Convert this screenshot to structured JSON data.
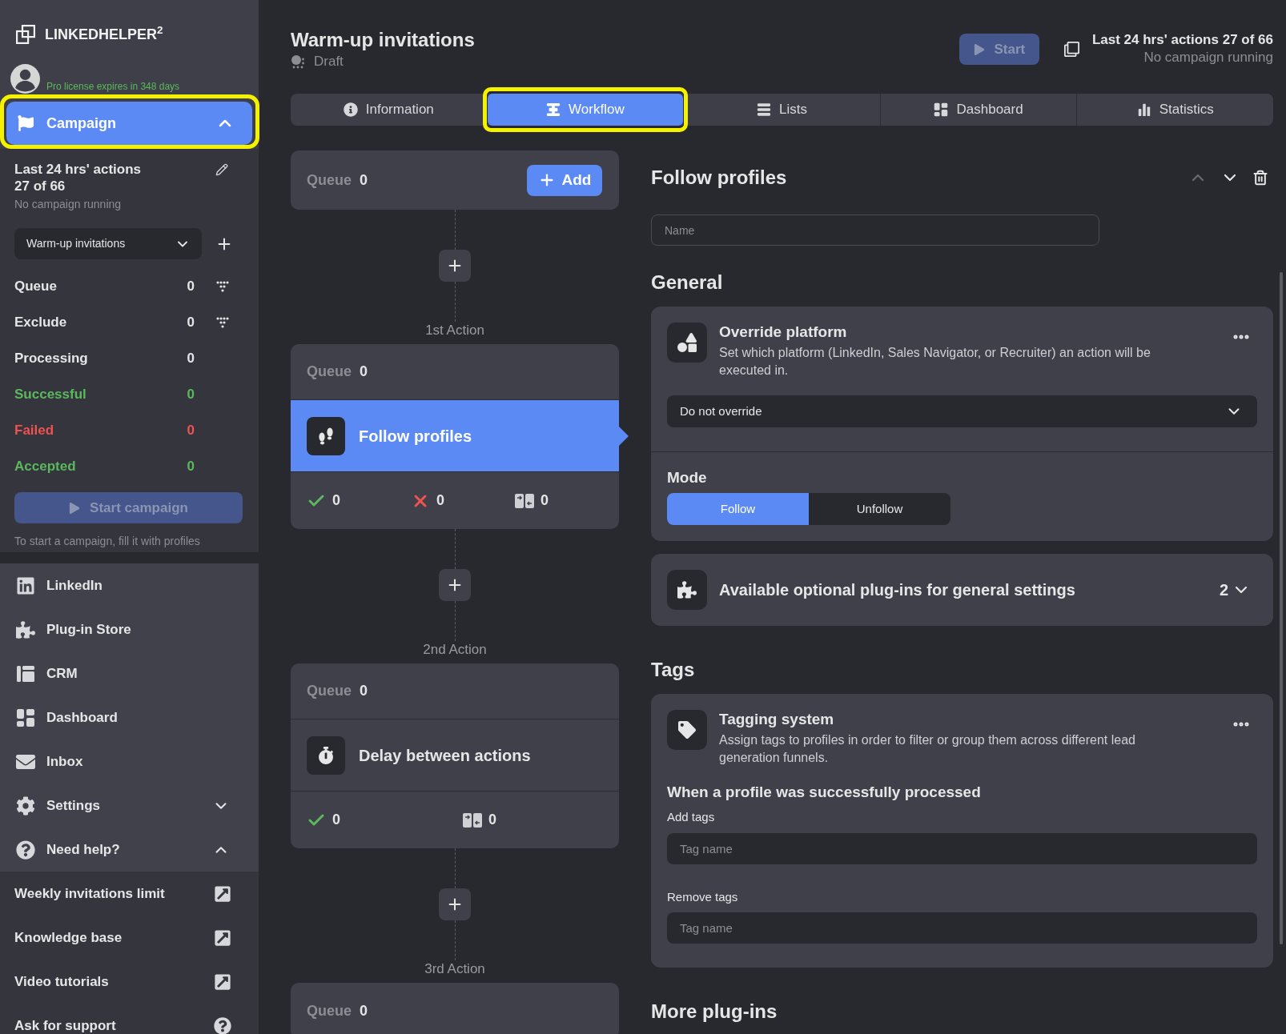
{
  "sidebar": {
    "logo": "LINKEDHELPER$^{2}$",
    "license": "Pro license expires in 348 days",
    "campaign_nav": {
      "label": "Campaign",
      "expanded": true,
      "highlighted": true
    },
    "actions_summary": {
      "title": "Last 24 hrs' actions",
      "count": "27 of 66",
      "status": "No campaign running"
    },
    "campaign_select": {
      "value": "Warm-up invitations"
    },
    "stats": [
      {
        "label": "Queue",
        "value": "0",
        "kind": "filter",
        "color": "#e6e6e6"
      },
      {
        "label": "Exclude",
        "value": "0",
        "kind": "filter",
        "color": "#e6e6e6"
      },
      {
        "label": "Processing",
        "value": "0",
        "kind": "plain",
        "color": "#e6e6e6"
      },
      {
        "label": "Successful",
        "value": "0",
        "kind": "plain",
        "color": "#5cb85c"
      },
      {
        "label": "Failed",
        "value": "0",
        "kind": "plain",
        "color": "#ee5350"
      },
      {
        "label": "Accepted",
        "value": "0",
        "kind": "plain",
        "color": "#5cb85c"
      }
    ],
    "start_button": {
      "label": "Start campaign",
      "disabled": true
    },
    "hint": "To start a campaign, fill it with profiles",
    "nav": [
      {
        "label": "LinkedIn"
      },
      {
        "label": "Plug-in Store"
      },
      {
        "label": "CRM"
      },
      {
        "label": "Dashboard"
      },
      {
        "label": "Inbox"
      },
      {
        "label": "Settings",
        "expanded": false
      },
      {
        "label": "Need help?",
        "expanded": true
      }
    ],
    "help_links": [
      {
        "label": "Weekly invitations limit",
        "kind": "external"
      },
      {
        "label": "Knowledge base",
        "kind": "external"
      },
      {
        "label": "Video tutorials",
        "kind": "external"
      },
      {
        "label": "Ask for support",
        "kind": "support"
      }
    ]
  },
  "header": {
    "title": "Warm-up invitations",
    "status": "Draft",
    "start_button": {
      "label": "Start",
      "disabled": true
    },
    "actions_summary": "Last 24 hrs' actions 27 of 66",
    "campaign_status": "No campaign running"
  },
  "tabs": [
    {
      "label": "Information",
      "selected": false,
      "highlighted": false
    },
    {
      "label": "Workflow",
      "selected": true,
      "highlighted": true
    },
    {
      "label": "Lists",
      "selected": false,
      "highlighted": false
    },
    {
      "label": "Dashboard",
      "selected": false,
      "highlighted": false
    },
    {
      "label": "Statistics",
      "selected": false,
      "highlighted": false
    }
  ],
  "workflow": {
    "source": {
      "queue_label": "Queue",
      "queue_count": "0",
      "add_button": "Add"
    },
    "steps": [
      {
        "step_label": "1st Action",
        "queue_label": "Queue",
        "queue_count": "0",
        "kind": "follow",
        "title": "Follow profiles",
        "selected": true,
        "results": [
          {
            "kind": "success",
            "count": "0"
          },
          {
            "kind": "failure",
            "count": "0"
          },
          {
            "kind": "skipped",
            "count": "0"
          }
        ]
      },
      {
        "step_label": "2nd Action",
        "queue_label": "Queue",
        "queue_count": "0",
        "kind": "delay",
        "title": "Delay between actions",
        "selected": false,
        "results": [
          {
            "kind": "success",
            "count": "0"
          },
          {
            "kind": "skipped",
            "count": "0"
          }
        ]
      },
      {
        "step_label": "3rd Action",
        "queue_label": "Queue",
        "queue_count": "0"
      }
    ]
  },
  "details": {
    "title": "Follow profiles",
    "move_up": {
      "disabled": true
    },
    "move_down": {
      "disabled": false
    },
    "name_field": {
      "placeholder": "Name"
    },
    "sections": [
      {
        "heading": "General",
        "cards": [
          {
            "kind": "platform",
            "title": "Override platform",
            "description": "Set which platform (LinkedIn, Sales Navigator, or Recruiter) an action will be executed in.",
            "select_value": "Do not override",
            "mode": {
              "label": "Mode",
              "options": [
                {
                  "label": "Follow",
                  "selected": true
                },
                {
                  "label": "Unfollow",
                  "selected": false
                }
              ]
            }
          },
          {
            "kind": "plugins",
            "title": "Available optional plug-ins for general settings",
            "count": "2",
            "expanded": false
          }
        ]
      },
      {
        "heading": "Tags",
        "cards": [
          {
            "kind": "tagging",
            "title": "Tagging system",
            "description": "Assign tags to profiles in order to filter or group them across different lead generation funnels.",
            "subheading": "When a profile was successfully processed",
            "fields": [
              {
                "label": "Add tags",
                "placeholder": "Tag name"
              },
              {
                "label": "Remove tags",
                "placeholder": "Tag name"
              }
            ]
          }
        ]
      },
      {
        "heading": "More plug-ins"
      }
    ]
  }
}
